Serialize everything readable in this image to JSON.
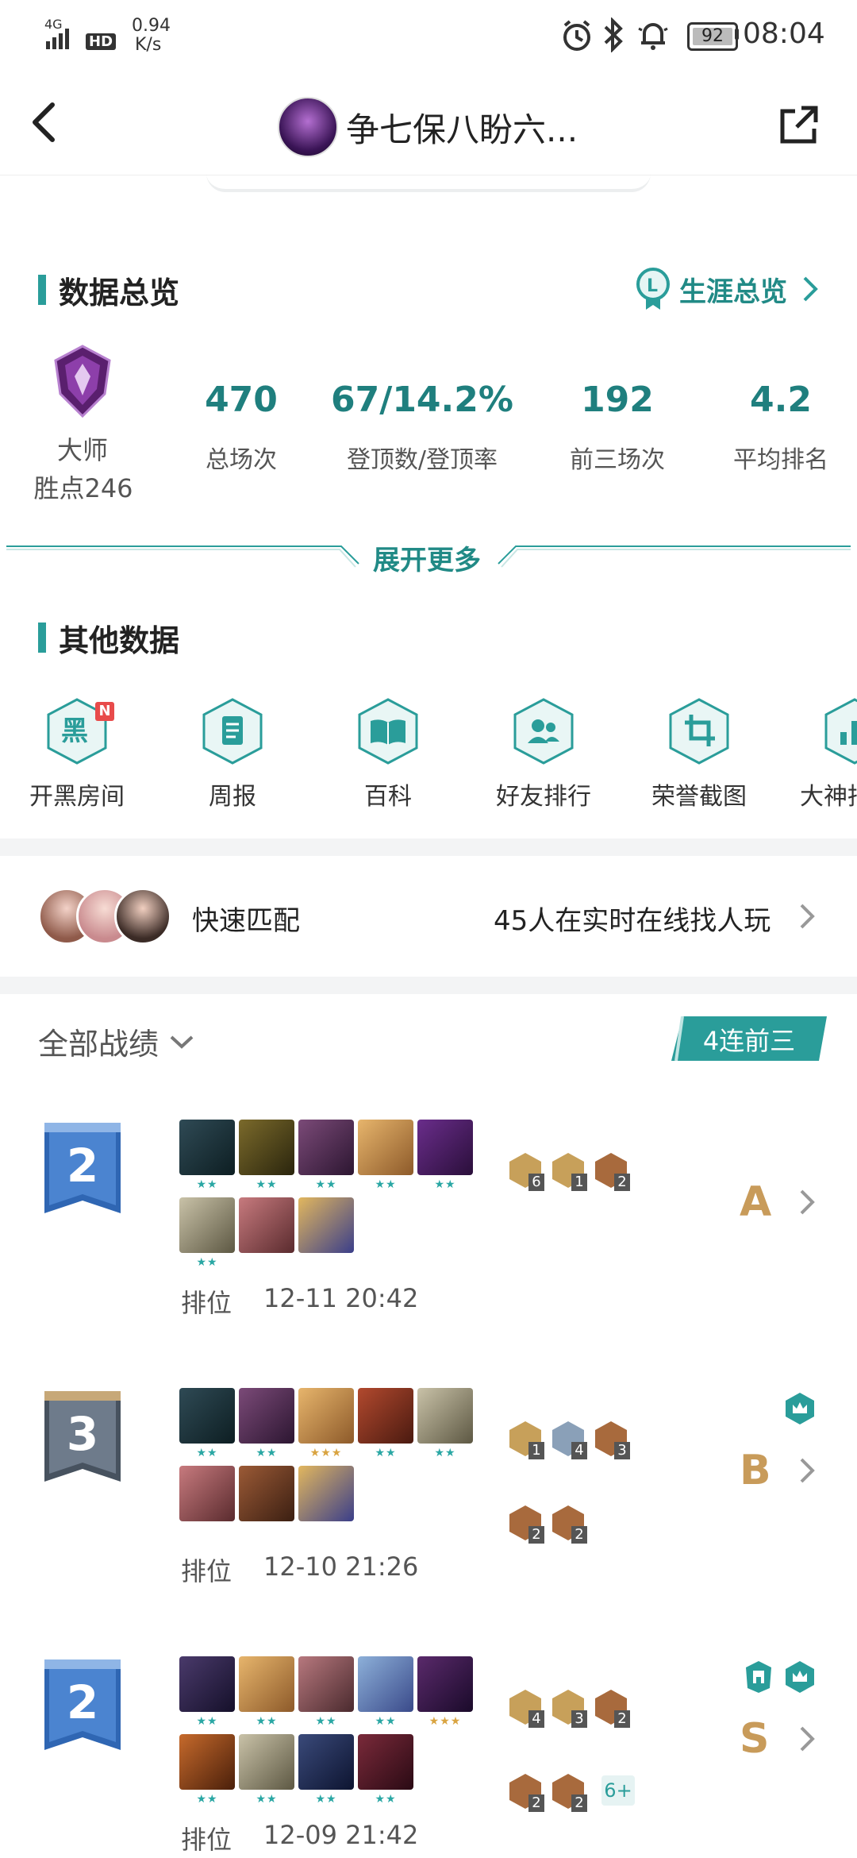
{
  "status_bar": {
    "network": "4G",
    "hd": "HD",
    "speed_value": "0.94",
    "speed_unit": "K/s",
    "battery": "92",
    "time": "08:04"
  },
  "header": {
    "title": "争七保八盼六..."
  },
  "overview": {
    "title": "数据总览",
    "career_link": "生涯总览",
    "rank_name": "大师",
    "rank_points": "胜点246",
    "stats": [
      {
        "value": "470",
        "label": "总场次"
      },
      {
        "value": "67/14.2%",
        "label": "登顶数/登顶率"
      },
      {
        "value": "192",
        "label": "前三场次"
      },
      {
        "value": "4.2",
        "label": "平均排名"
      }
    ],
    "expand": "展开更多"
  },
  "other": {
    "title": "其他数据",
    "items": [
      {
        "label": "开黑房间",
        "icon": "room-icon",
        "badge": "N"
      },
      {
        "label": "周报",
        "icon": "report-icon"
      },
      {
        "label": "百科",
        "icon": "book-icon"
      },
      {
        "label": "好友排行",
        "icon": "friends-icon"
      },
      {
        "label": "荣誉截图",
        "icon": "crop-icon"
      },
      {
        "label": "大神指",
        "icon": "chart-icon"
      }
    ]
  },
  "quick_match": {
    "label": "快速匹配",
    "online": "45人在实时在线找人玩"
  },
  "records": {
    "filter": "全部战绩",
    "streak": "4连前三",
    "matches": [
      {
        "place": "2",
        "mode": "排位",
        "time": "12-11 20:42",
        "grade": "A",
        "heroes_row1": [
          "★★",
          "★★",
          "★★",
          "★★",
          "★★"
        ],
        "heroes_row2": [
          "★★",
          "",
          ""
        ],
        "traits": [
          "6",
          "1",
          "2"
        ],
        "traits2": []
      },
      {
        "place": "3",
        "mode": "排位",
        "time": "12-10 21:26",
        "grade": "B",
        "heroes_row1": [
          "★★",
          "★★",
          "★★★",
          "★★",
          "★★"
        ],
        "heroes_row2": [
          "",
          "",
          ""
        ],
        "traits": [
          "1",
          "4",
          "3"
        ],
        "traits2": [
          "2",
          "2"
        ]
      },
      {
        "place": "2",
        "mode": "排位",
        "time": "12-09 21:42",
        "grade": "S",
        "heroes_row1": [
          "★★",
          "★★",
          "★★",
          "★★",
          "★★★"
        ],
        "heroes_row2": [
          "★★",
          "★★",
          "★★",
          "★★"
        ],
        "traits": [
          "4",
          "3",
          "2"
        ],
        "traits2": [
          "2",
          "2"
        ],
        "more": "6+"
      }
    ]
  },
  "colors": {
    "accent": "#218a86",
    "grade": "#c89b5a",
    "divider": "#f3f4f5"
  }
}
